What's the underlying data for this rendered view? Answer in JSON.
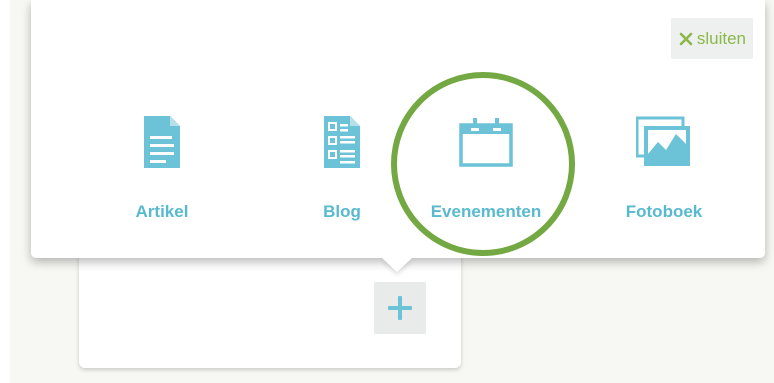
{
  "popup": {
    "close_label": "sluiten",
    "close_icon": "x-icon",
    "options": [
      {
        "label": "Artikel",
        "icon": "document-icon"
      },
      {
        "label": "Blog",
        "icon": "list-document-icon"
      },
      {
        "label": "Evenementen",
        "icon": "calendar-icon"
      },
      {
        "label": "Fotoboek",
        "icon": "photo-album-icon"
      }
    ]
  },
  "card": {
    "add_icon": "plus-icon"
  },
  "colors": {
    "accent_blue": "#58b9cf",
    "close_green": "#8ab84a",
    "highlight_green": "#74a843",
    "background": "#f7f7f3"
  }
}
